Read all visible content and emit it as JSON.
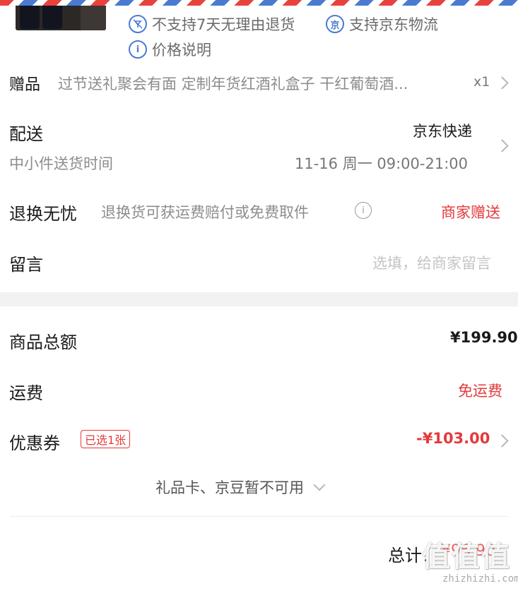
{
  "product": {
    "services": [
      {
        "icon": "no-return-icon",
        "text": "不支持7天无理由退货"
      },
      {
        "icon": "jd-logistics-icon",
        "icon_text": "京",
        "text": "支持京东物流"
      },
      {
        "icon": "info-icon",
        "icon_text": "i",
        "text": "价格说明"
      }
    ]
  },
  "gift": {
    "label": "赠品",
    "name": "过节送礼聚会有面 定制年货红酒礼盒子 干红葡萄酒...",
    "qty": "x1"
  },
  "delivery": {
    "label": "配送",
    "carrier": "京东快递",
    "time_label": "中小件送货时间",
    "time_value": "11-16 周一 09:00-21:00"
  },
  "returns": {
    "label": "退换无忧",
    "desc": "退换货可获运费赔付或免费取件",
    "status": "商家赠送"
  },
  "message": {
    "label": "留言",
    "placeholder": "选填，给商家留言"
  },
  "summary": {
    "subtotal_label": "商品总额",
    "subtotal_value": "¥199.90",
    "shipping_label": "运费",
    "shipping_value": "免运费",
    "coupon_label": "优惠券",
    "coupon_badge": "已选1张",
    "coupon_value": "-¥103.00",
    "giftcard_text": "礼品卡、京豆暂不可用",
    "total_label": "总计：",
    "total_value": "¥96.90"
  },
  "watermark": {
    "text": "值值值",
    "url": "zhizhizhi.com"
  },
  "colors": {
    "accent_red": "#e4393c",
    "link_blue": "#4a7bd1",
    "muted": "#8c8c8c"
  }
}
